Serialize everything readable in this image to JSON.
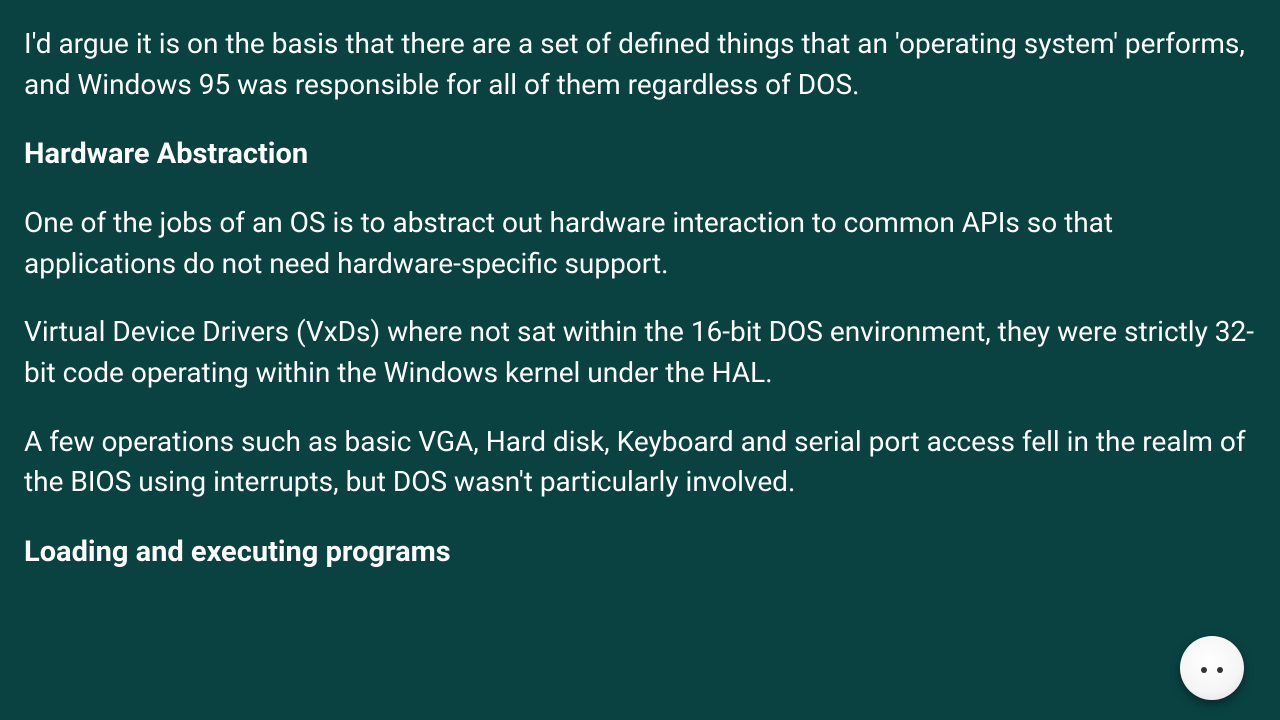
{
  "article": {
    "intro": "I'd argue it is on the basis that there are a set of defined things that an 'operating system' performs, and Windows 95 was responsible for all of them regardless of DOS.",
    "section1": {
      "heading": "Hardware Abstraction",
      "p1": "One of the jobs of an OS is to abstract out hardware interaction to common APIs so that applications do not need hardware-specific support.",
      "p2": "Virtual Device Drivers (VxDs) where not sat within the 16-bit DOS environment, they were strictly 32-bit code operating within the Windows kernel under the HAL.",
      "p3": "A few operations such as basic VGA, Hard disk, Keyboard and serial port access fell in the realm of the BIOS using interrupts, but DOS wasn't particularly involved."
    },
    "section2": {
      "heading": "Loading and executing programs"
    }
  },
  "colors": {
    "background": "#0a4242",
    "text": "#ffffff"
  }
}
